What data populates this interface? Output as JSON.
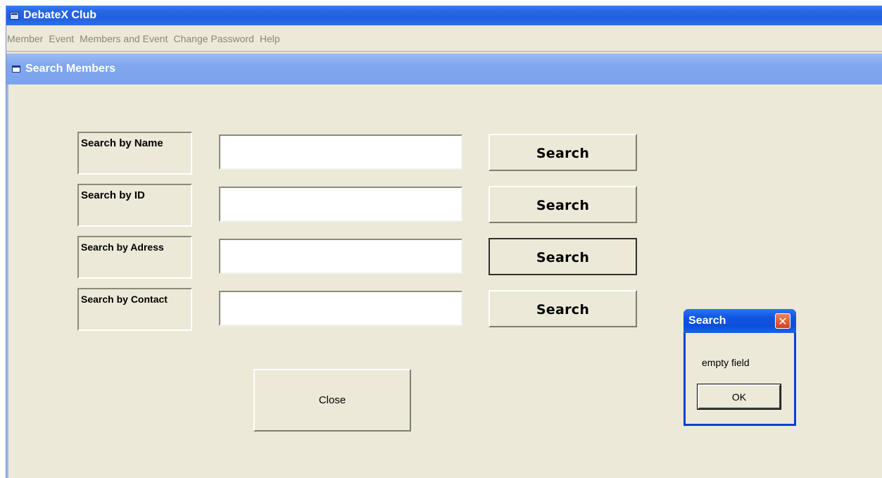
{
  "app": {
    "title": "DebateX Club"
  },
  "menu": [
    "Member",
    "Event",
    "Members and Event",
    "Change Password",
    "Help"
  ],
  "child_window": {
    "title": "Search Members"
  },
  "search_rows": [
    {
      "label": "Search by Name",
      "value": "",
      "button": "Search"
    },
    {
      "label": "Search by ID",
      "value": "",
      "button": "Search"
    },
    {
      "label": "Search by Adress",
      "value": "",
      "button": "Search"
    },
    {
      "label": "Search by Contact",
      "value": "",
      "button": "Search"
    }
  ],
  "close_button": "Close",
  "dialog": {
    "title": "Search",
    "close_glyph": "✕",
    "message": "empty field",
    "ok_label": "OK"
  },
  "colors": {
    "xp_blue": "#0a3fd8",
    "window_bg": "#ece9d8",
    "inactive_title": "#7fa6ee"
  }
}
